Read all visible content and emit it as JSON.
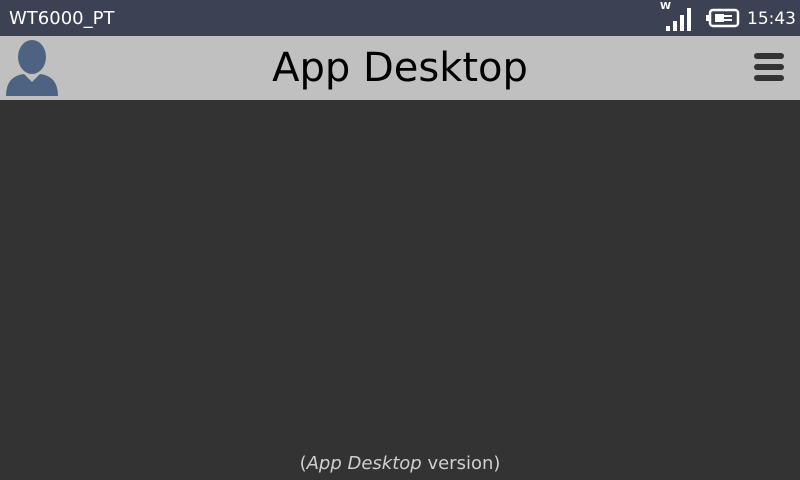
{
  "status_bar": {
    "device_name": "WT6000_PT",
    "wifi_label": "W",
    "time": "15:43",
    "icons": {
      "signal": "signal-strength-icon",
      "battery": "battery-charging-icon"
    }
  },
  "header": {
    "title": "App Desktop",
    "avatar_icon": "user-avatar-icon",
    "menu_icon": "hamburger-menu-icon"
  },
  "footer": {
    "open_paren": "(",
    "app_name": "App Desktop",
    "version_text": " version)"
  },
  "colors": {
    "status_bar": "#3c4253",
    "header_bg": "#c0c0c0",
    "content_bg": "#333333",
    "avatar": "#4e6282"
  }
}
